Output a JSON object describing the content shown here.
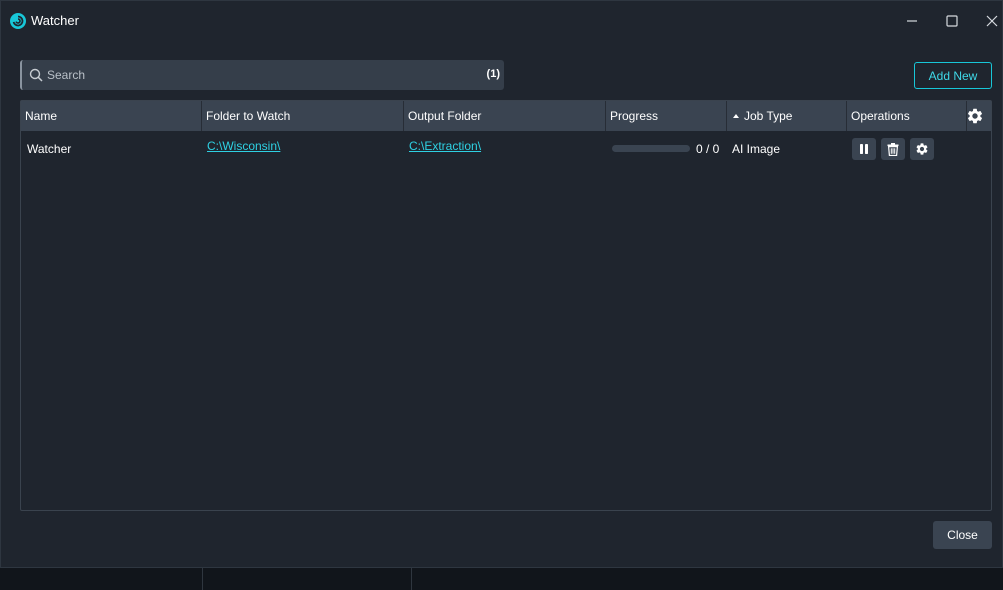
{
  "window": {
    "title": "Watcher",
    "accent_color": "#18c7d8"
  },
  "toolbar": {
    "search_placeholder": "Search",
    "search_value": "",
    "result_count": "(1)",
    "add_new_label": "Add New"
  },
  "grid": {
    "columns": [
      "Name",
      "Folder to Watch",
      "Output Folder",
      "Progress",
      "Job Type",
      "Operations"
    ],
    "sort_indicator": "ascending",
    "rows": [
      {
        "name": "Watcher",
        "folder_to_watch": "C:\\Wisconsin\\",
        "output_folder": "C:\\Extraction\\",
        "progress_fraction": 0,
        "progress_text": "0 / 0",
        "job_type": "AI Image",
        "operations": [
          "pause-icon",
          "trash-icon",
          "gear-icon"
        ]
      }
    ]
  },
  "footer": {
    "close_label": "Close"
  }
}
